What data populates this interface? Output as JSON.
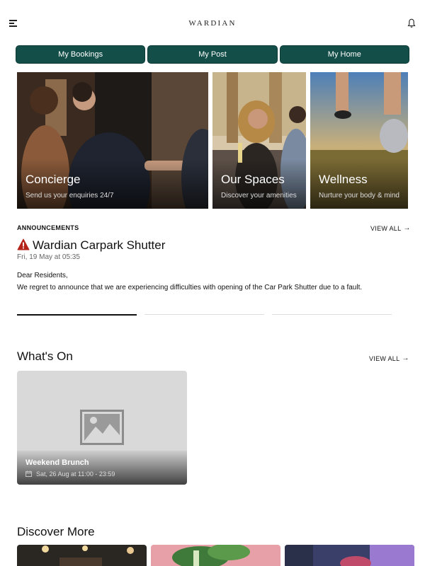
{
  "header": {
    "logo": "WARDIAN",
    "menu_icon": "hamburger-menu-icon",
    "notify_icon": "bell-icon"
  },
  "tabs": [
    {
      "label": "My Bookings"
    },
    {
      "label": "My Post"
    },
    {
      "label": "My Home"
    }
  ],
  "feature_cards": [
    {
      "title": "Concierge",
      "subtitle": "Send us your enquiries 24/7"
    },
    {
      "title": "Our Spaces",
      "subtitle": "Discover your amenities"
    },
    {
      "title": "Wellness",
      "subtitle": "Nurture your body & mind"
    }
  ],
  "announcements": {
    "label": "ANNOUNCEMENTS",
    "view_all": "VIEW ALL",
    "title": "Wardian Carpark Shutter",
    "date": "Fri, 19 May at 05:35",
    "greeting": "Dear Residents,",
    "body": "We regret to announce that we are experiencing difficulties with opening of the Car Park Shutter due to a fault.",
    "pager_active_index": 0
  },
  "whats_on": {
    "heading": "What's On",
    "view_all": "VIEW ALL",
    "event": {
      "title": "Weekend Brunch",
      "date": "Sat, 26 Aug at 11:00 - 23:59"
    }
  },
  "discover": {
    "heading": "Discover More"
  },
  "colors": {
    "brand": "#134e48",
    "warning": "#b42318"
  }
}
